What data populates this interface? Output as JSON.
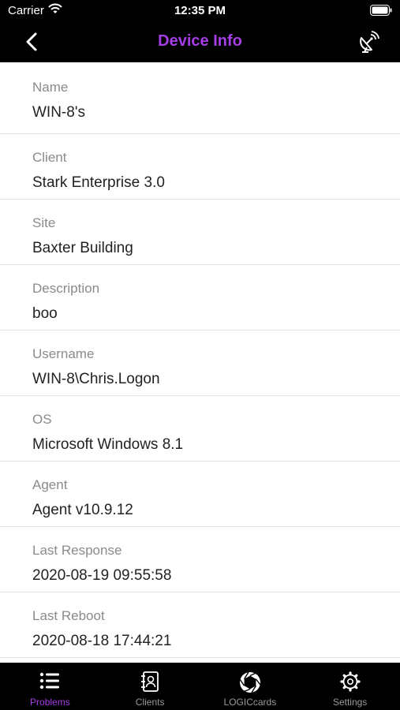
{
  "status_bar": {
    "carrier": "Carrier",
    "time": "12:35 PM"
  },
  "nav": {
    "title": "Device Info",
    "title_color": "#a53ee6",
    "back_icon": "chevron-left",
    "right_icon": "satellite-dish"
  },
  "fields": [
    {
      "label": "Name",
      "value": "WIN-8's"
    },
    {
      "label": "Client",
      "value": "Stark Enterprise 3.0"
    },
    {
      "label": "Site",
      "value": "Baxter Building"
    },
    {
      "label": "Description",
      "value": "boo"
    },
    {
      "label": "Username",
      "value": "WIN-8\\Chris.Logon"
    },
    {
      "label": "OS",
      "value": "Microsoft Windows 8.1"
    },
    {
      "label": "Agent",
      "value": "Agent v10.9.12"
    },
    {
      "label": "Last Response",
      "value": "2020-08-19 09:55:58"
    },
    {
      "label": "Last Reboot",
      "value": "2020-08-18 17:44:21"
    }
  ],
  "tabs": [
    {
      "label": "Problems",
      "icon": "list-icon",
      "active": true
    },
    {
      "label": "Clients",
      "icon": "contacts-icon",
      "active": false
    },
    {
      "label": "LOGICcards",
      "icon": "aperture-icon",
      "active": false
    },
    {
      "label": "Settings",
      "icon": "gear-icon",
      "active": false
    }
  ],
  "colors": {
    "accent": "#a53ee6",
    "bar_background": "#000000",
    "inactive_tab": "#9a9a9a"
  }
}
